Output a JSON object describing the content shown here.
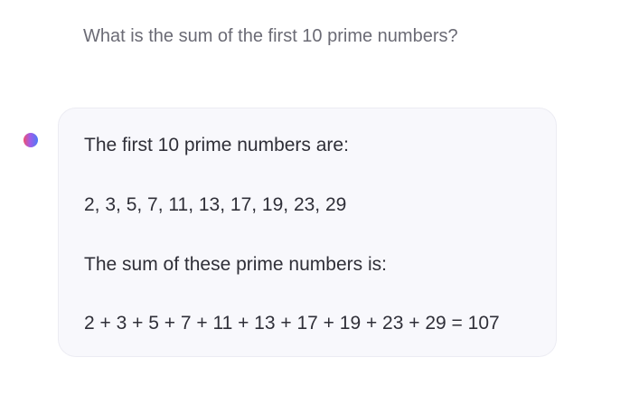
{
  "conversation": {
    "user_message": "What is the sum of the first 10 prime numbers?",
    "assistant": {
      "avatar_icon": "gradient-circle-icon",
      "lines": [
        "The first 10 prime numbers are:",
        "2, 3, 5, 7, 11, 13, 17, 19, 23, 29",
        "The sum of these prime numbers is:",
        "2 + 3 + 5 + 7 + 11 + 13 + 17 + 19 + 23 + 29 = 107"
      ]
    }
  },
  "colors": {
    "user_text": "#6b6b75",
    "assistant_text": "#2f2f38",
    "card_background": "#f8f8fc",
    "card_border": "#ececf3",
    "avatar_gradient": [
      "#ef4f6f",
      "#a15ce8",
      "#4d7cf5"
    ]
  }
}
